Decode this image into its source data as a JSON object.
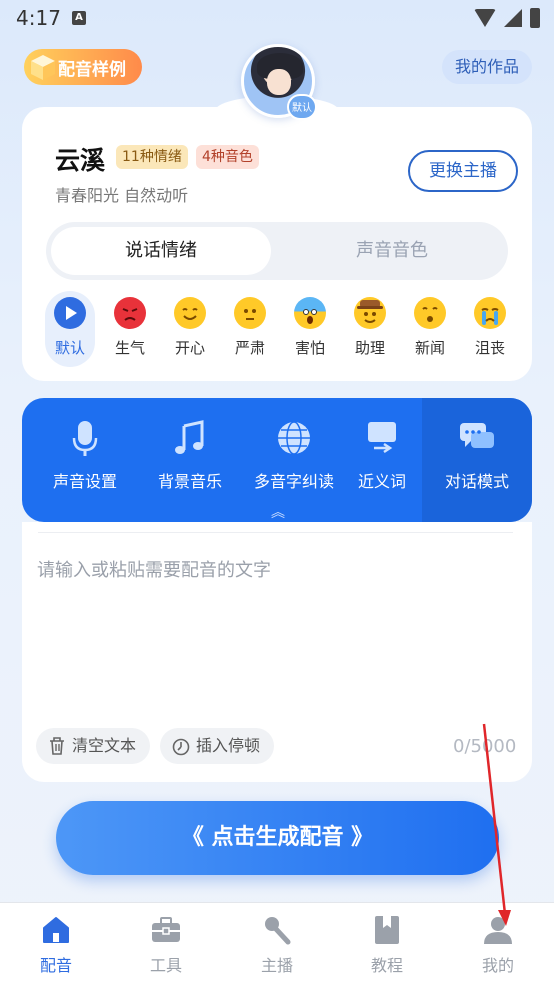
{
  "status_bar": {
    "time": "4:17",
    "a_badge": "A"
  },
  "header": {
    "sample_button": "配音样例",
    "my_works_button": "我的作品",
    "avatar_badge": "默认"
  },
  "anchor": {
    "name": "云溪",
    "tags": [
      "11种情绪",
      "4种音色"
    ],
    "description": "青春阳光 自然动听",
    "change_button": "更换主播",
    "segments": [
      "说话情绪",
      "声音音色"
    ]
  },
  "emotions": [
    {
      "label": "默认",
      "active": true,
      "icon": "play-icon"
    },
    {
      "label": "生气",
      "icon": "angry-face-icon"
    },
    {
      "label": "开心",
      "icon": "happy-face-icon"
    },
    {
      "label": "严肃",
      "icon": "serious-face-icon"
    },
    {
      "label": "害怕",
      "icon": "scared-face-icon"
    },
    {
      "label": "助理",
      "icon": "cowboy-face-icon"
    },
    {
      "label": "新闻",
      "icon": "whistle-face-icon"
    },
    {
      "label": "沮丧",
      "icon": "crying-face-icon"
    }
  ],
  "tools": [
    {
      "label": "声音设置",
      "icon": "microphone-icon"
    },
    {
      "label": "背景音乐",
      "icon": "music-note-icon"
    },
    {
      "label": "多音字纠读",
      "icon": "globe-icon"
    },
    {
      "label": "近义词",
      "icon": "swap-icon"
    },
    {
      "label": "对话模式",
      "icon": "chat-bubbles-icon"
    }
  ],
  "editor": {
    "placeholder": "请输入或粘贴需要配音的文字",
    "clear_button": "清空文本",
    "pause_button": "插入停顿",
    "counter": "0/5000"
  },
  "generate_button": "《 点击生成配音 》",
  "nav": [
    {
      "label": "配音",
      "active": true,
      "icon": "home-icon"
    },
    {
      "label": "工具",
      "icon": "toolbox-icon"
    },
    {
      "label": "主播",
      "icon": "microphone-icon"
    },
    {
      "label": "教程",
      "icon": "book-icon"
    },
    {
      "label": "我的",
      "icon": "person-icon"
    }
  ],
  "colors": {
    "accent": "#1e6ff0",
    "tag_gold": "#fbe7b9",
    "tag_red": "#fde0d8",
    "annotation_arrow": "#e0262a"
  }
}
